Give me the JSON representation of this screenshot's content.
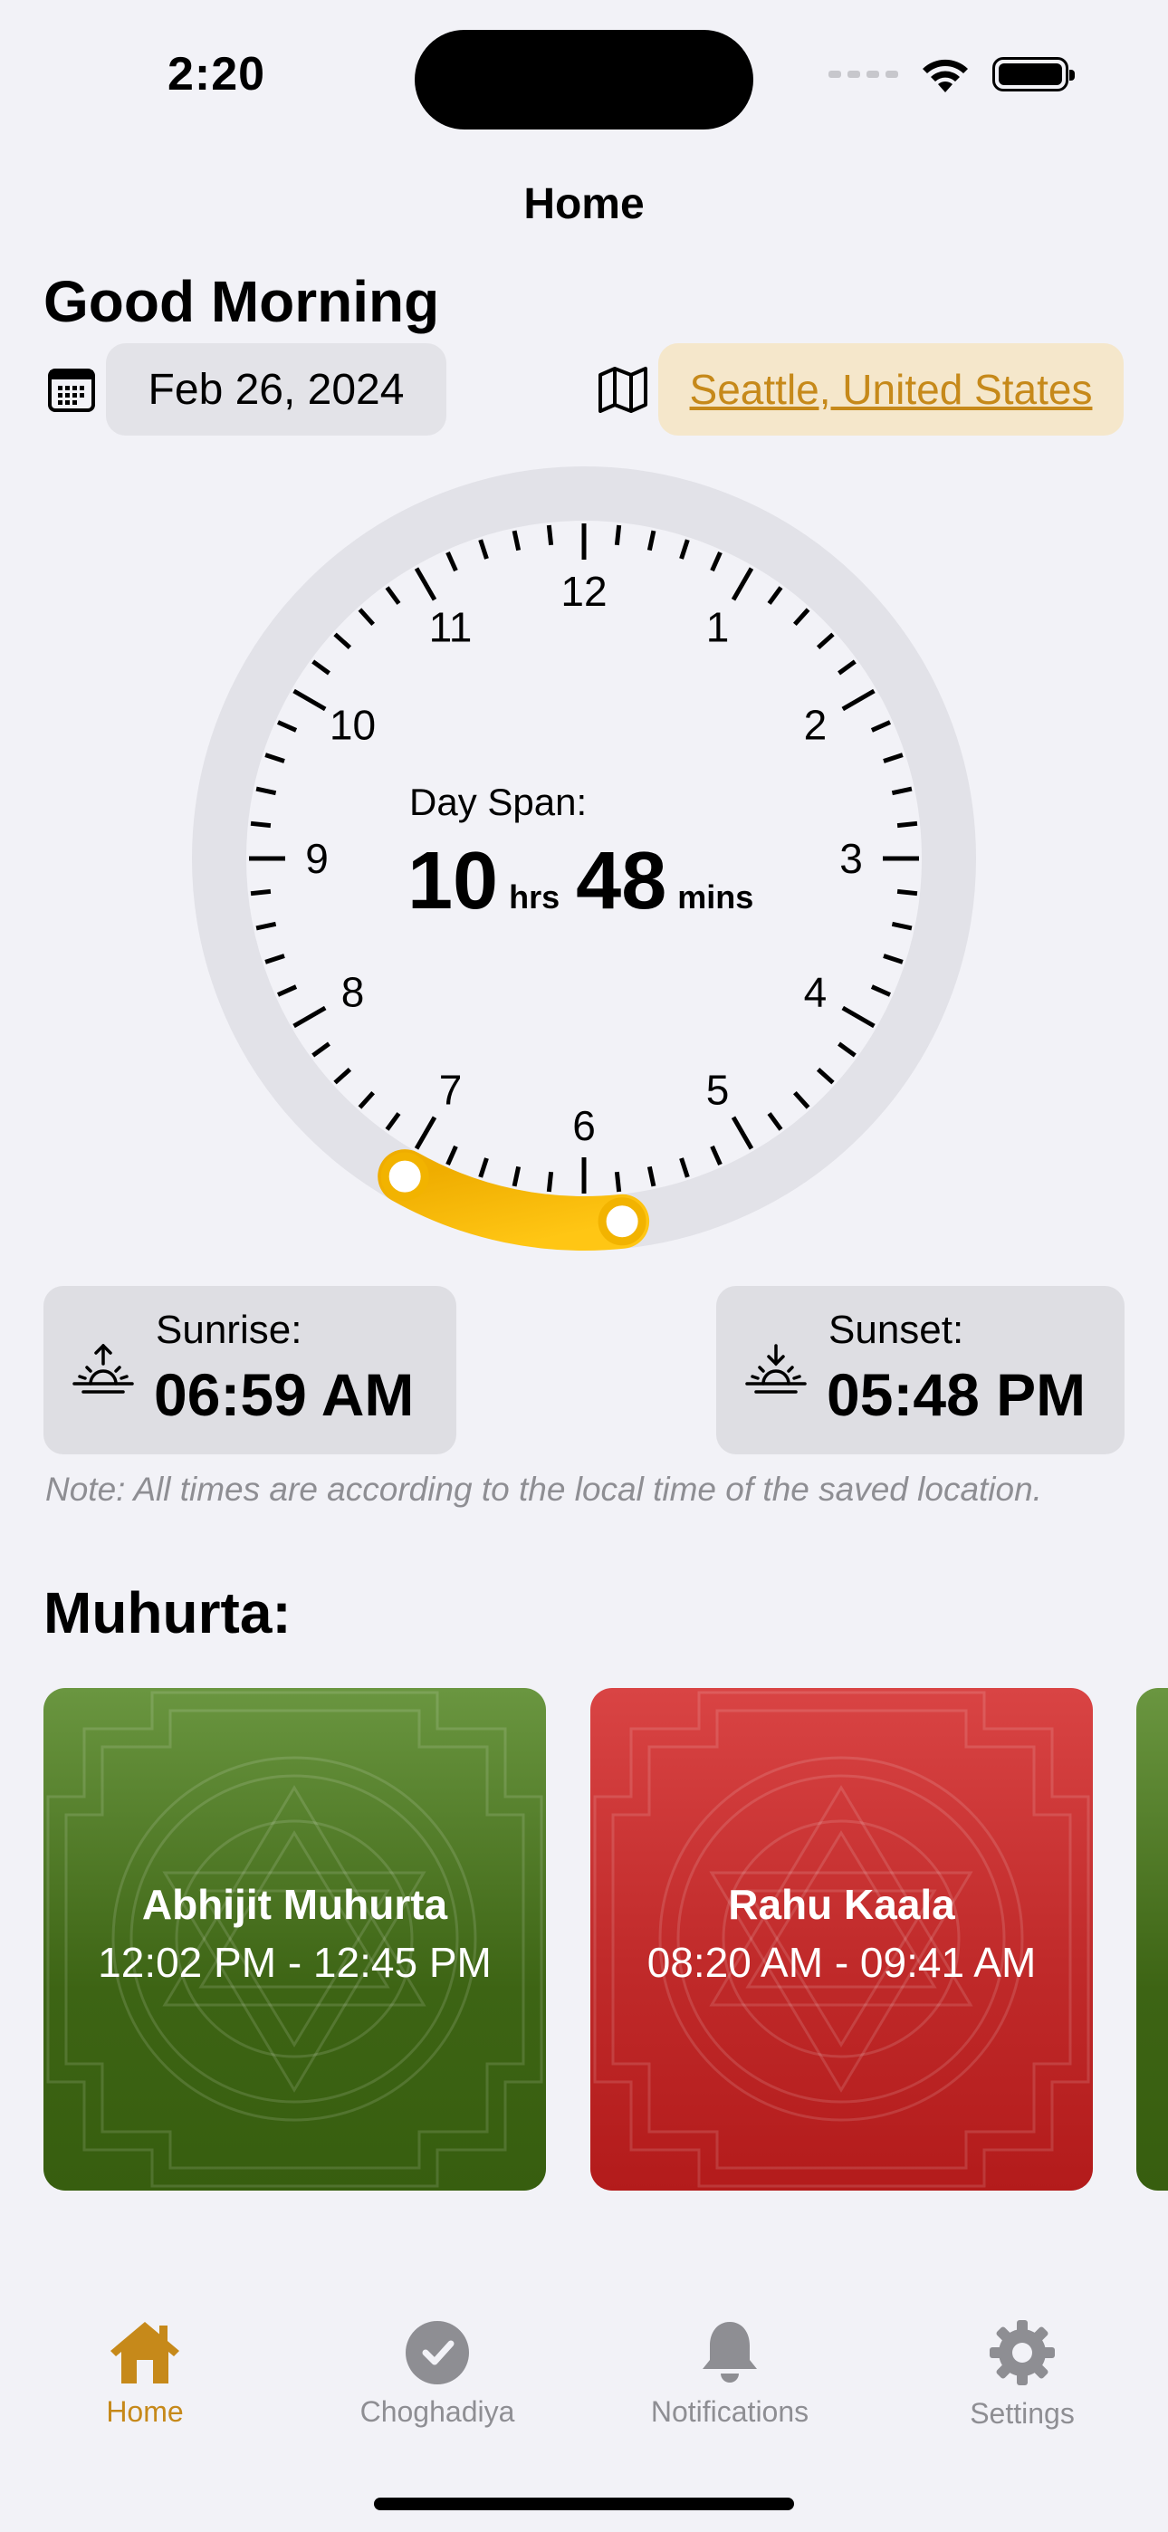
{
  "status": {
    "time": "2:20"
  },
  "nav": {
    "title": "Home"
  },
  "greeting": "Good Morning",
  "date": "Feb 26, 2024",
  "location": "Seattle, United States",
  "dial": {
    "label": "Day Span:",
    "hours": "10",
    "hours_unit": "hrs",
    "minutes": "48",
    "minutes_unit": "mins",
    "numbers": [
      "12",
      "1",
      "2",
      "3",
      "4",
      "5",
      "6",
      "7",
      "8",
      "9",
      "10",
      "11"
    ],
    "sunrise_hour": 6.98,
    "sunset_hour": 17.8,
    "accent": "#f2b300"
  },
  "sunrise": {
    "label": "Sunrise:",
    "value": "06:59 AM"
  },
  "sunset": {
    "label": "Sunset:",
    "value": "05:48 PM"
  },
  "note": "Note: All times are according to the local time of the saved location.",
  "section_title": "Muhurta:",
  "muhurta": [
    {
      "title": "Abhijit Muhurta",
      "time": "12:02 PM - 12:45 PM",
      "color": "#4a7a1f"
    },
    {
      "title": "Rahu Kaala",
      "time": "08:20 AM - 09:41 AM",
      "color": "#c62828"
    }
  ],
  "tabs": [
    {
      "label": "Home",
      "icon": "house-icon",
      "active": true
    },
    {
      "label": "Choghadiya",
      "icon": "clock-check-icon",
      "active": false
    },
    {
      "label": "Notifications",
      "icon": "bell-icon",
      "active": false
    },
    {
      "label": "Settings",
      "icon": "gear-icon",
      "active": false
    }
  ],
  "colors": {
    "active_tab": "#c6891a",
    "inactive_tab": "#8e8e93"
  }
}
